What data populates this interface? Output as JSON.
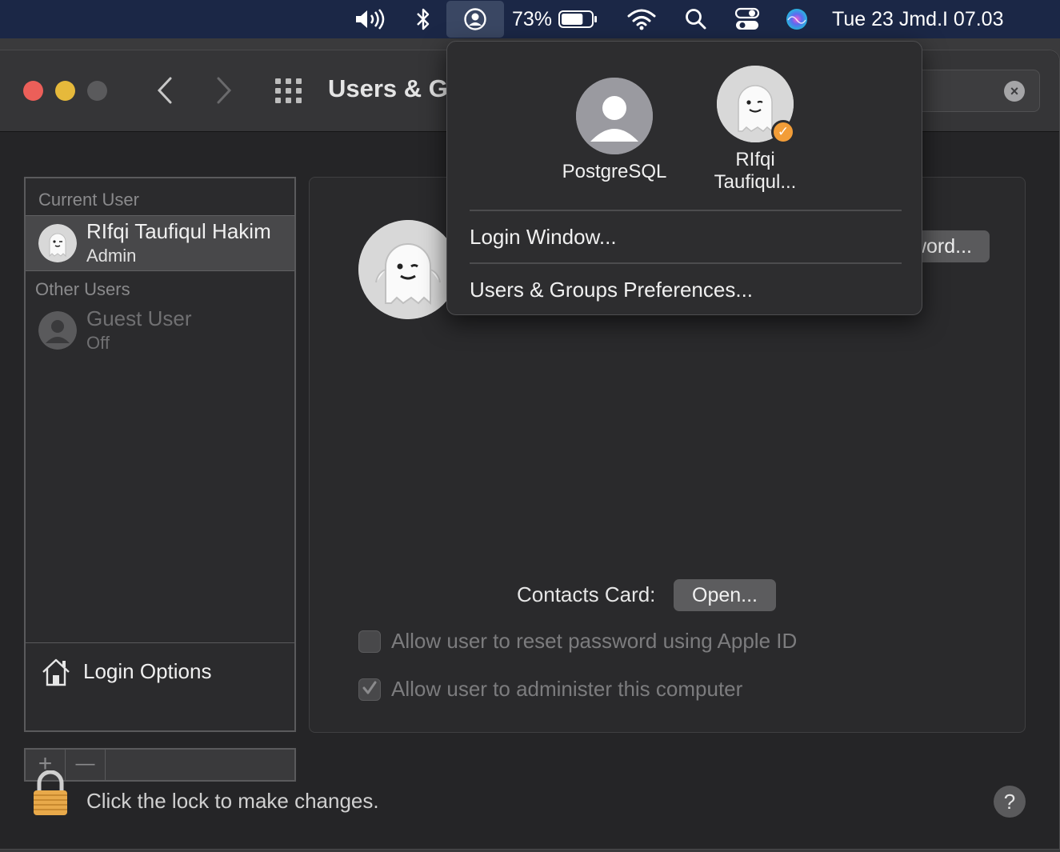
{
  "menubar": {
    "battery_percent": "73%",
    "battery_level": 0.73,
    "clock": "Tue 23 Jmd.I  07.03",
    "icons": [
      "volume-icon",
      "bluetooth-icon",
      "user-switch-icon",
      "battery-icon",
      "wifi-icon",
      "search-icon",
      "control-center-icon",
      "siri-icon"
    ]
  },
  "window": {
    "title": "Users & Groups"
  },
  "sidebar": {
    "current_user_header": "Current User",
    "other_users_header": "Other Users",
    "current_user": {
      "name": "RIfqi Taufiqul Hakim",
      "role": "Admin"
    },
    "guest_user": {
      "name": "Guest User",
      "status": "Off"
    },
    "login_options_label": "Login Options",
    "add_label": "+",
    "remove_label": "—"
  },
  "detail": {
    "change_password_label": "Change Password...",
    "contacts_card_label": "Contacts Card:",
    "open_button_label": "Open...",
    "reset_password_label": "Allow user to reset password using Apple ID",
    "reset_password_checked": false,
    "administer_label": "Allow user to administer this computer",
    "administer_checked": true
  },
  "footer": {
    "lock_text": "Click the lock to make changes.",
    "help_label": "?"
  },
  "popover": {
    "users": [
      {
        "name": "PostgreSQL"
      },
      {
        "name": "RIfqi Taufiqul...",
        "name_line1": "RIfqi",
        "name_line2": "Taufiqul...",
        "active": true
      }
    ],
    "login_window_label": "Login Window...",
    "preferences_label": "Users & Groups Preferences..."
  },
  "colors": {
    "menubar_bg": "#1b2746",
    "close": "#ec5f59",
    "minimize": "#e6b93b",
    "badge": "#f29d38"
  }
}
